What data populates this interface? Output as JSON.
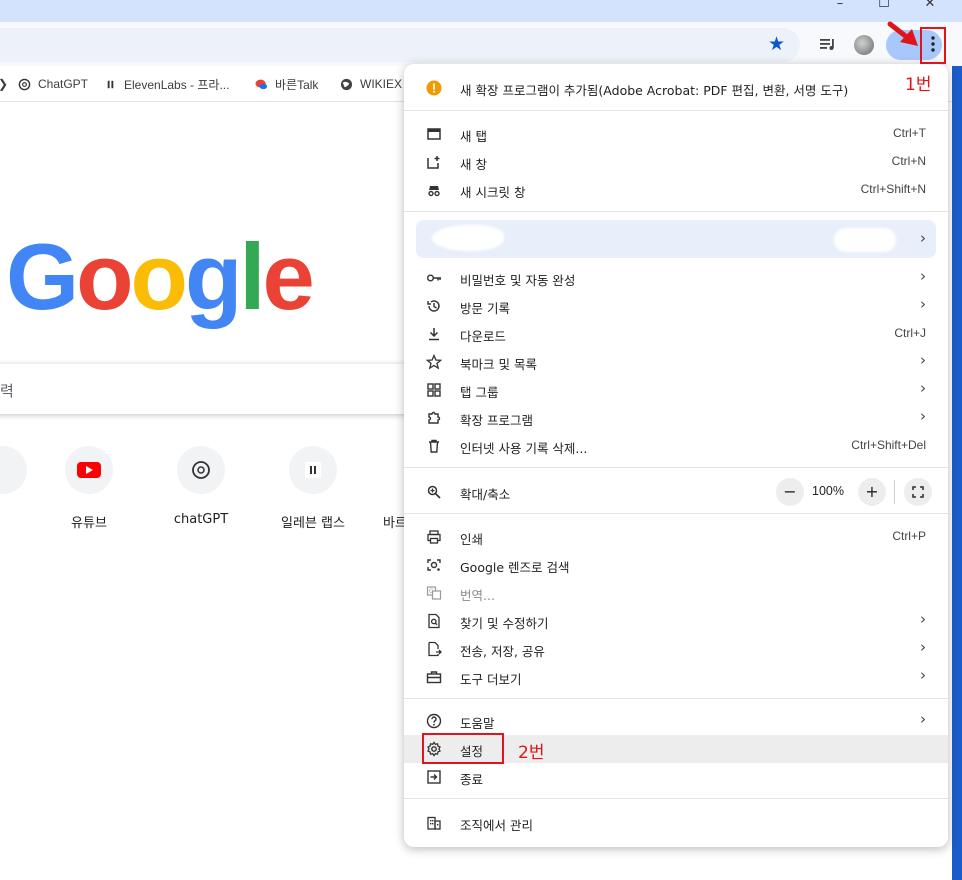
{
  "window": {
    "minimize_glyph": "–",
    "maximize_glyph": "☐",
    "close_glyph": "✕"
  },
  "bookmarks": [
    {
      "label": "ChatGPT",
      "icon": "openai-icon"
    },
    {
      "label": "ElevenLabs - 프라...",
      "icon": "elevenlabs-icon"
    },
    {
      "label": "바른Talk",
      "icon": "chat-icon"
    },
    {
      "label": "WIKIEX",
      "icon": "globe-icon"
    }
  ],
  "newtab": {
    "logo": [
      "G",
      "o",
      "o",
      "g",
      "l",
      "e"
    ],
    "logo_colors": [
      "#4285F4",
      "#EA4335",
      "#FBBC05",
      "#4285F4",
      "#34A853",
      "#EA4335"
    ],
    "search_placeholder_fragment": "력",
    "shortcuts": [
      {
        "label": "유튜브",
        "icon": "youtube-icon"
      },
      {
        "label": "chatGPT",
        "icon": "openai-icon"
      },
      {
        "label": "일레븐 랩스",
        "icon": "elevenlabs-icon"
      },
      {
        "label": "바르",
        "icon": "chat-icon"
      }
    ]
  },
  "menu": {
    "notice": "새 확장 프로그램이 추가됨(Adobe Acrobat: PDF 편집, 변환, 서명 도구)",
    "group1": [
      {
        "label": "새 탭",
        "shortcut": "Ctrl+T",
        "icon": "new-tab-icon"
      },
      {
        "label": "새 창",
        "shortcut": "Ctrl+N",
        "icon": "new-window-icon"
      },
      {
        "label": "새 시크릿 창",
        "shortcut": "Ctrl+Shift+N",
        "icon": "incognito-icon"
      }
    ],
    "group2": [
      {
        "label": "비밀번호 및 자동 완성",
        "shortcut": "",
        "icon": "key-icon",
        "submenu": true
      },
      {
        "label": "방문 기록",
        "shortcut": "",
        "icon": "history-icon",
        "submenu": true
      },
      {
        "label": "다운로드",
        "shortcut": "Ctrl+J",
        "icon": "download-icon",
        "submenu": false
      },
      {
        "label": "북마크 및 목록",
        "shortcut": "",
        "icon": "star-icon",
        "submenu": true
      },
      {
        "label": "탭 그룹",
        "shortcut": "",
        "icon": "tab-groups-icon",
        "submenu": true
      },
      {
        "label": "확장 프로그램",
        "shortcut": "",
        "icon": "extension-icon",
        "submenu": true
      },
      {
        "label": "인터넷 사용 기록 삭제...",
        "shortcut": "Ctrl+Shift+Del",
        "icon": "trash-icon",
        "submenu": false
      }
    ],
    "zoom": {
      "label": "확대/축소",
      "minus": "−",
      "value": "100%",
      "plus": "+"
    },
    "group3": [
      {
        "label": "인쇄",
        "shortcut": "Ctrl+P",
        "icon": "print-icon",
        "submenu": false,
        "disabled": false
      },
      {
        "label": "Google 렌즈로 검색",
        "shortcut": "",
        "icon": "lens-icon",
        "submenu": false,
        "disabled": false
      },
      {
        "label": "번역...",
        "shortcut": "",
        "icon": "translate-icon",
        "submenu": false,
        "disabled": true
      },
      {
        "label": "찾기 및 수정하기",
        "shortcut": "",
        "icon": "find-icon",
        "submenu": true,
        "disabled": false
      },
      {
        "label": "전송, 저장, 공유",
        "shortcut": "",
        "icon": "share-icon",
        "submenu": true,
        "disabled": false
      },
      {
        "label": "도구 더보기",
        "shortcut": "",
        "icon": "toolbox-icon",
        "submenu": true,
        "disabled": false
      }
    ],
    "group4": [
      {
        "label": "도움말",
        "shortcut": "",
        "icon": "help-icon",
        "submenu": true
      },
      {
        "label": "설정",
        "shortcut": "",
        "icon": "gear-icon",
        "submenu": false
      },
      {
        "label": "종료",
        "shortcut": "",
        "icon": "exit-icon",
        "submenu": false
      }
    ],
    "managed": {
      "label": "조직에서 관리",
      "icon": "building-icon"
    }
  },
  "annotations": {
    "step1": "1번",
    "step2": "2번",
    "color": "#e0141b"
  }
}
